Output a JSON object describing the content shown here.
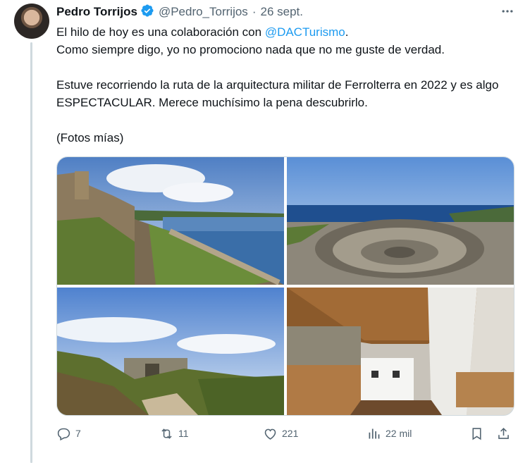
{
  "tweet": {
    "author_name": "Pedro Torrijos",
    "handle": "@Pedro_Torrijos",
    "separator": "·",
    "date": "26 sept.",
    "text_line1_prefix": "El hilo de hoy es una colaboración con ",
    "mention": "@DACTurismo",
    "text_line1_suffix": ".",
    "text_line2": "Como siempre digo, yo no promociono nada que no me guste de verdad.",
    "text_para2": "Estuve recorriendo la ruta de la arquitectura militar de Ferrolterra en 2022 y es algo ESPECTACULAR. Merece muchísimo la pena descubrirlo.",
    "text_para3": "(Fotos mías)"
  },
  "actions": {
    "replies": "7",
    "reposts": "11",
    "likes": "221",
    "views": "22 mil"
  },
  "icons": {
    "verified": "verified-badge-icon",
    "more": "more-options-icon",
    "reply": "reply-icon",
    "repost": "repost-icon",
    "like": "like-icon",
    "views": "views-icon",
    "bookmark": "bookmark-icon",
    "share": "share-icon"
  },
  "colors": {
    "accent": "#1d9bf0",
    "text": "#0f1419",
    "muted": "#536471",
    "border": "#cfd9de"
  }
}
